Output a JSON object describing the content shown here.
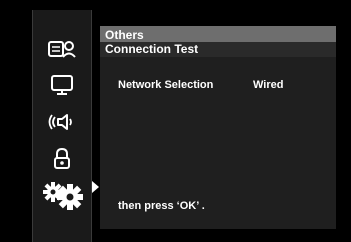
{
  "menu": {
    "section_title": "Others",
    "subtitle": "Connection Test"
  },
  "sidebar": {
    "items": [
      {
        "icon": "display-user-icon"
      },
      {
        "icon": "monitor-icon"
      },
      {
        "icon": "speaker-icon"
      },
      {
        "icon": "lock-icon"
      },
      {
        "icon": "gears-icon",
        "selected": true
      }
    ]
  },
  "settings": [
    {
      "label": "Network Selection",
      "value": "Wired"
    }
  ],
  "footer": {
    "hint": "then press ‘OK’ ."
  },
  "colors": {
    "background": "#000000",
    "sidebar": "#1a1a1a",
    "panel": "#1f1f1f",
    "header_highlight": "#6e6e6e",
    "text": "#ffffff"
  }
}
